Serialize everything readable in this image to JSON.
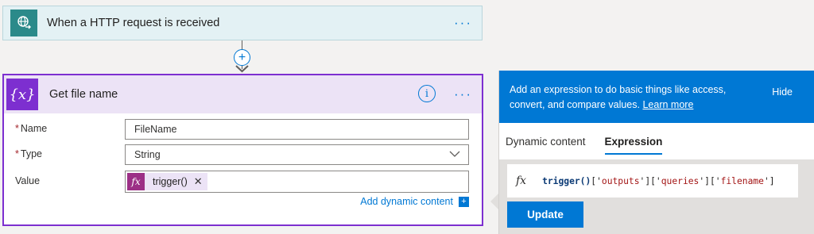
{
  "trigger": {
    "title": "When a HTTP request is received",
    "more": "···"
  },
  "connector": {
    "plus": "+"
  },
  "variable_card": {
    "title": "Get file name",
    "info": "i",
    "more": "···",
    "fields": {
      "name": {
        "required_mark": "*",
        "label": "Name",
        "value": "FileName"
      },
      "type": {
        "required_mark": "*",
        "label": "Type",
        "value": "String"
      },
      "value": {
        "label": "Value",
        "token_icon": "fx",
        "token_text": "trigger()",
        "token_remove": "✕"
      }
    },
    "add_dynamic_label": "Add dynamic content",
    "add_dynamic_icon": "+"
  },
  "expression_panel": {
    "description": "Add an expression to do basic things like access, convert, and compare values.",
    "learn_more": "Learn more",
    "hide": "Hide",
    "tabs": [
      "Dynamic content",
      "Expression"
    ],
    "active_tab": "Expression",
    "expression": {
      "fx": "fx",
      "function": "trigger()",
      "parts": [
        "outputs",
        "queries",
        "filename"
      ]
    },
    "update_label": "Update"
  },
  "colors": {
    "trigger_accent": "#2b8a8a",
    "variable_accent": "#7d2fd0",
    "primary_blue": "#0078d4",
    "token_fx": "#9c2f86"
  }
}
